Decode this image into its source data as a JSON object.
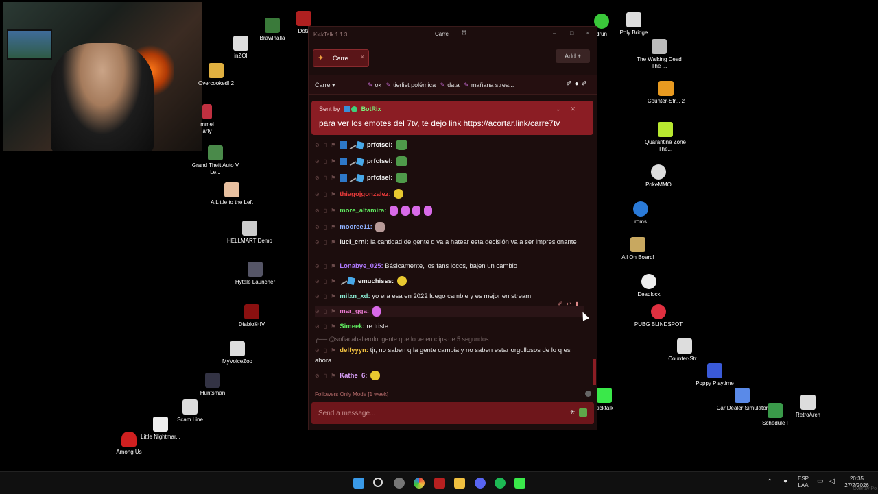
{
  "window": {
    "app_title": "KickTalk 1.1.3",
    "channel_title": "Carre",
    "minimize": "–",
    "maximize": "□",
    "close": "×"
  },
  "tabs": [
    {
      "label": "Carre",
      "close": "×"
    }
  ],
  "add_button": "Add  +",
  "channel_bar": {
    "name": "Carre ▾",
    "pinned_emotes": [
      "ok",
      "tierlist polémica",
      "data",
      "mañana strea..."
    ]
  },
  "pinned_message": {
    "sent_by_label": "Sent by",
    "bot_name": "BotRix",
    "text": "para ver los emotes del 7tv, te dejo link ",
    "link": "https://acortar.link/carre7tv"
  },
  "messages": [
    {
      "user": "prfctsel:",
      "color": "#ffffff",
      "text": ""
    },
    {
      "user": "prfctsel:",
      "color": "#ffffff",
      "text": ""
    },
    {
      "user": "prfctsel:",
      "color": "#ffffff",
      "text": ""
    },
    {
      "user": "thiagojgonzalez:",
      "color": "#e83a3a",
      "text": ""
    },
    {
      "user": "more_altamira:",
      "color": "#5fe85f",
      "text": ""
    },
    {
      "user": "mooree11:",
      "color": "#8fb0ff",
      "text": ""
    },
    {
      "user": "luci_crnl:",
      "color": "#ffffff",
      "text": "la cantidad de gente q va a hatear esta decisión va a ser impresionante"
    },
    {
      "user": "Lonabye_025:",
      "color": "#b07aff",
      "text": "Básicamente, los fans locos, bajen un cambio"
    },
    {
      "user": "emuchisss:",
      "color": "#ffffff",
      "text": ""
    },
    {
      "user": "milxn_xd:",
      "color": "#8ae8d0",
      "text": "yo era esa en 2022 luego cambie y es mejor en stream"
    },
    {
      "user": "mar_gga:",
      "color": "#e87ad0",
      "text": ""
    },
    {
      "user": "Simeek:",
      "color": "#5fe85f",
      "text": "re triste"
    },
    {
      "user": "delfyyyn:",
      "color": "#f0c040",
      "text": "tjr, no saben q la gente cambia y no saben estar orgullosos de lo q es ahora"
    },
    {
      "user": "Kathe_6:",
      "color": "#d8a0f8",
      "text": ""
    }
  ],
  "reply": {
    "user": "@sofiacaballerolo:",
    "text": "gente que lo ve en clips de 5 segundos"
  },
  "footer_mode": "Followers Only Mode [1 week]",
  "input_placeholder": "Send a message...",
  "desktop_icons": [
    {
      "label": "Brawlhalla"
    },
    {
      "label": "Dota"
    },
    {
      "label": "inZOI"
    },
    {
      "label": "Overcooked! 2"
    },
    {
      "label": "mmel arty"
    },
    {
      "label": "Grand Theft Auto V Le..."
    },
    {
      "label": "A Little to the Left"
    },
    {
      "label": "HELLMART Demo"
    },
    {
      "label": "Hytale Launcher"
    },
    {
      "label": "Diablo® IV"
    },
    {
      "label": "MyVoiceZoo"
    },
    {
      "label": "Huntsman"
    },
    {
      "label": "Scam Line"
    },
    {
      "label": "Little Nightmar..."
    },
    {
      "label": "Among Us"
    },
    {
      "label": "drun"
    },
    {
      "label": "Poly Bridge"
    },
    {
      "label": "The Walking Dead The ..."
    },
    {
      "label": "Counter-Str... 2"
    },
    {
      "label": "Quarantine Zone The..."
    },
    {
      "label": "PokeMMO"
    },
    {
      "label": "roms"
    },
    {
      "label": "All On Board!"
    },
    {
      "label": "Deadlock"
    },
    {
      "label": "PUBG BLINDSPOT"
    },
    {
      "label": "Counter-Str..."
    },
    {
      "label": "Poppy Playtime"
    },
    {
      "label": "kicktalk"
    },
    {
      "label": "Car Dealer Simulator"
    },
    {
      "label": "Schedule I"
    },
    {
      "label": "RetroArch"
    }
  ],
  "taskbar": {
    "lang_1": "ESP",
    "lang_2": "LAA",
    "time": "20:35",
    "date": "27/2/2026"
  },
  "watermark": "Overlay Po"
}
